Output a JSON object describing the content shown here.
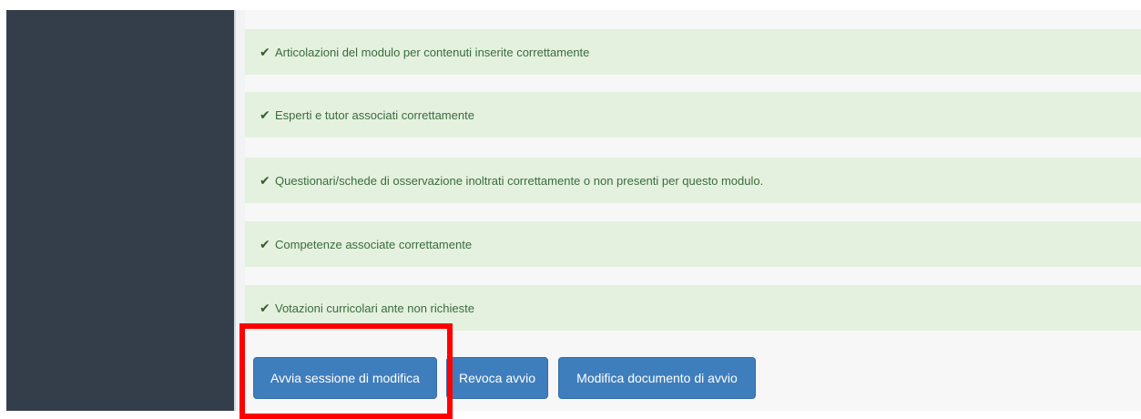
{
  "messages": [
    "Articolazioni del modulo per contenuti inserite correttamente",
    "Esperti e tutor associati correttamente",
    "Questionari/schede di osservazione inoltrati correttamente o non presenti per questo modulo.",
    "Competenze associate correttamente",
    "Votazioni curricolari ante non richieste"
  ],
  "actions": {
    "start_edit_session": "Avvia sessione di modifica",
    "revoke_start": "Revoca avvio",
    "edit_start_document": "Modifica documento di avvio"
  },
  "icons": {
    "check": "check-icon"
  },
  "colors": {
    "sidebar": "#343e4b",
    "success_bg": "#e4f1df",
    "success_text": "#3b6b3d",
    "primary_button": "#3f7ebc",
    "highlight": "#ff0000"
  }
}
